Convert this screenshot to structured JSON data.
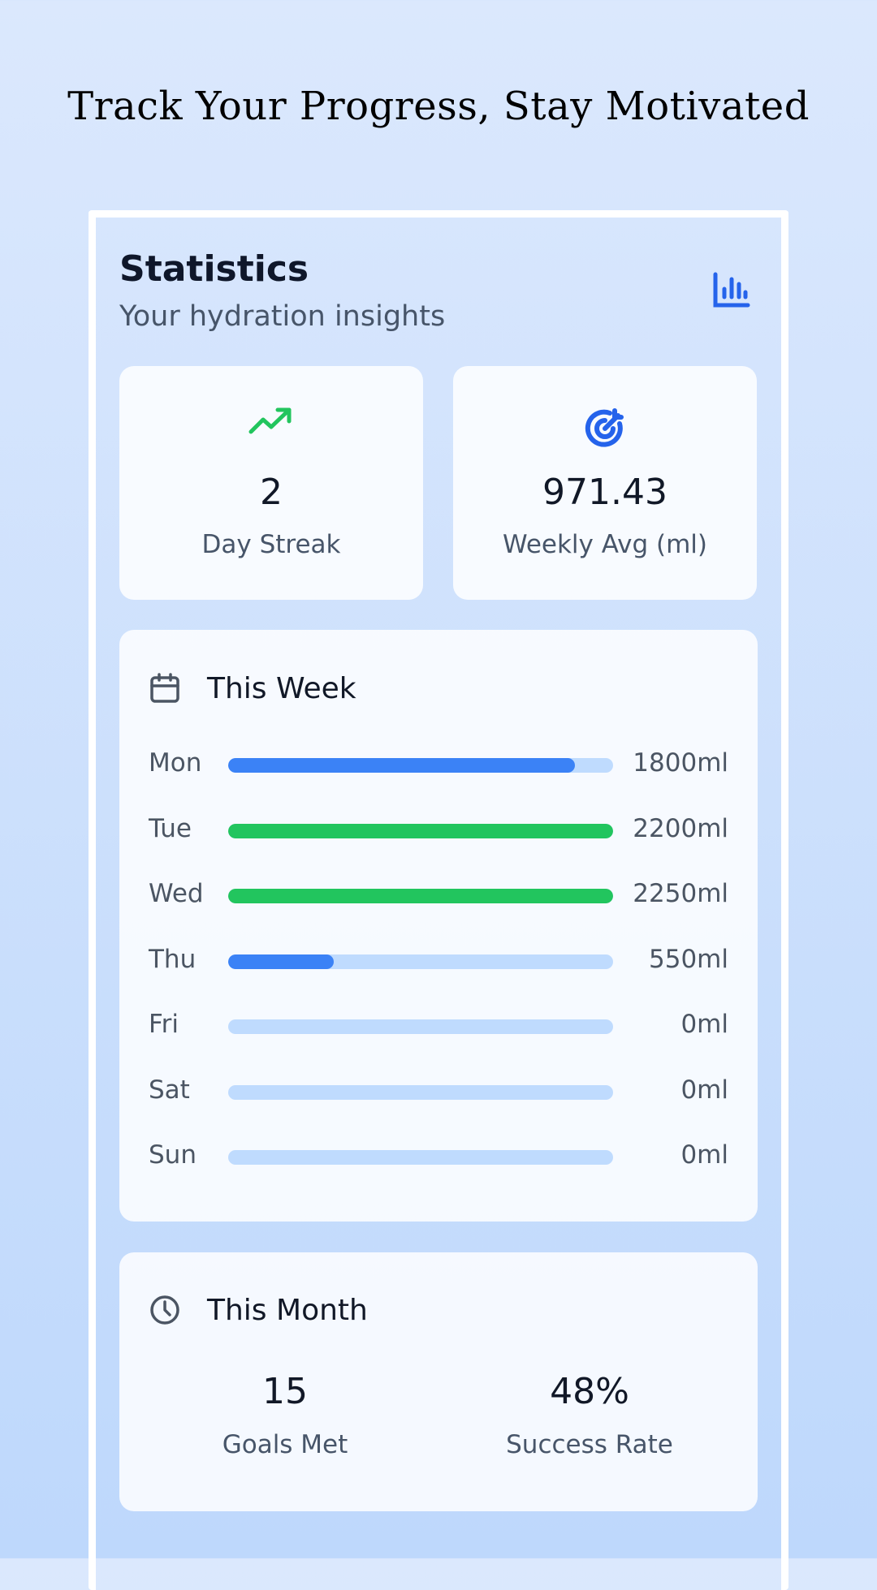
{
  "headline": "Track Your Progress, Stay Motivated",
  "statistics": {
    "title": "Statistics",
    "subtitle": "Your hydration insights",
    "icon": "bar-chart-icon"
  },
  "kpis": [
    {
      "icon": "trending-up-icon",
      "value": "2",
      "label": "Day Streak",
      "color": "#22c55e"
    },
    {
      "icon": "target-icon",
      "value": "971.43",
      "label": "Weekly Avg (ml)",
      "color": "#2563eb"
    }
  ],
  "week": {
    "title": "This Week",
    "icon": "calendar-icon",
    "goal_ml": 2000,
    "days": [
      {
        "day": "Mon",
        "amount": "1800ml",
        "progress": 0.9,
        "status": "partial"
      },
      {
        "day": "Tue",
        "amount": "2200ml",
        "progress": 1.0,
        "status": "met"
      },
      {
        "day": "Wed",
        "amount": "2250ml",
        "progress": 1.0,
        "status": "met"
      },
      {
        "day": "Thu",
        "amount": "550ml",
        "progress": 0.275,
        "status": "partial"
      },
      {
        "day": "Fri",
        "amount": "0ml",
        "progress": 0,
        "status": "none"
      },
      {
        "day": "Sat",
        "amount": "0ml",
        "progress": 0,
        "status": "none"
      },
      {
        "day": "Sun",
        "amount": "0ml",
        "progress": 0,
        "status": "none"
      }
    ],
    "colors": {
      "partial": "#3b82f6",
      "met": "#22c55e",
      "track": "#bfdbfe"
    }
  },
  "month": {
    "title": "This Month",
    "icon": "clock-icon",
    "stats": [
      {
        "value": "15",
        "label": "Goals Met"
      },
      {
        "value": "48%",
        "label": "Success Rate"
      }
    ]
  }
}
